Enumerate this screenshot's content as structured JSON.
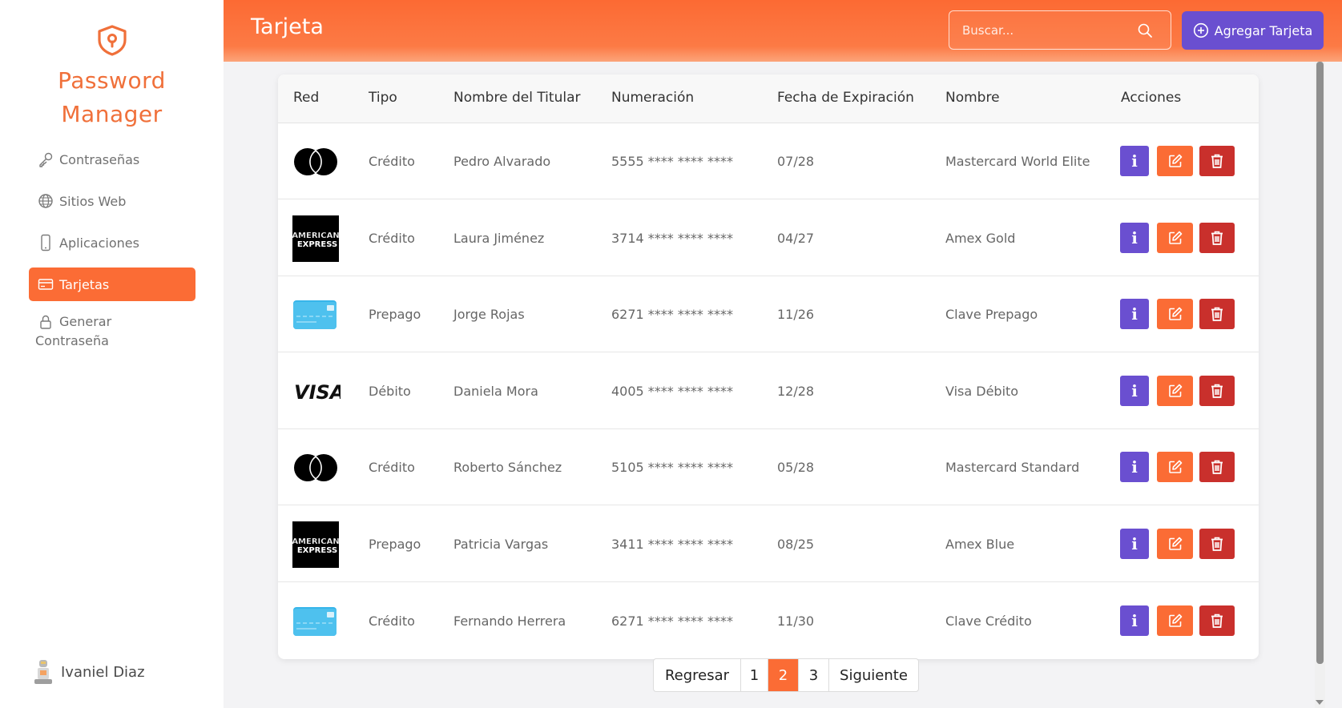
{
  "app": {
    "brand_line1": "Password",
    "brand_line2": "Manager",
    "accent": "#fb6c35",
    "purple": "#6a4fd0",
    "danger": "#c9302c"
  },
  "sidebar": {
    "items": [
      {
        "label": "Contraseñas",
        "icon": "key-icon",
        "active": false
      },
      {
        "label": "Sitios Web",
        "icon": "globe-icon",
        "active": false
      },
      {
        "label": "Aplicaciones",
        "icon": "phone-icon",
        "active": false
      },
      {
        "label": "Tarjetas",
        "icon": "credit-card-icon",
        "active": true
      },
      {
        "label_line1": "Generar",
        "label_line2": "Contraseña",
        "icon": "lock-icon",
        "active": false
      }
    ],
    "user_name": "Ivaniel Diaz"
  },
  "header": {
    "title": "Tarjeta",
    "search_placeholder": "Buscar...",
    "add_label": "Agregar Tarjeta"
  },
  "table": {
    "columns": [
      "Red",
      "Tipo",
      "Nombre del Titular",
      "Numeración",
      "Fecha de Expiración",
      "Nombre",
      "Acciones"
    ],
    "rows": [
      {
        "network": "mastercard",
        "tipo": "Crédito",
        "titular": "Pedro Alvarado",
        "numero": "5555 **** **** ****",
        "expira": "07/28",
        "nombre": "Mastercard World Elite"
      },
      {
        "network": "amex",
        "tipo": "Crédito",
        "titular": "Laura Jiménez",
        "numero": "3714 **** **** ****",
        "expira": "04/27",
        "nombre": "Amex Gold"
      },
      {
        "network": "generic",
        "tipo": "Prepago",
        "titular": "Jorge Rojas",
        "numero": "6271 **** **** ****",
        "expira": "11/26",
        "nombre": "Clave Prepago"
      },
      {
        "network": "visa",
        "tipo": "Débito",
        "titular": "Daniela Mora",
        "numero": "4005 **** **** ****",
        "expira": "12/28",
        "nombre": "Visa Débito"
      },
      {
        "network": "mastercard",
        "tipo": "Crédito",
        "titular": "Roberto Sánchez",
        "numero": "5105 **** **** ****",
        "expira": "05/28",
        "nombre": "Mastercard Standard"
      },
      {
        "network": "amex",
        "tipo": "Prepago",
        "titular": "Patricia Vargas",
        "numero": "3411 **** **** ****",
        "expira": "08/25",
        "nombre": "Amex Blue"
      },
      {
        "network": "generic",
        "tipo": "Crédito",
        "titular": "Fernando Herrera",
        "numero": "6271 **** **** ****",
        "expira": "11/30",
        "nombre": "Clave Crédito"
      }
    ]
  },
  "logos": {
    "amex_line1": "AMERICAN",
    "amex_line2": "EXPRESS",
    "visa": "VISA"
  },
  "pagination": {
    "prev": "Regresar",
    "pages": [
      "1",
      "2",
      "3"
    ],
    "active_page": "2",
    "next": "Siguiente"
  }
}
